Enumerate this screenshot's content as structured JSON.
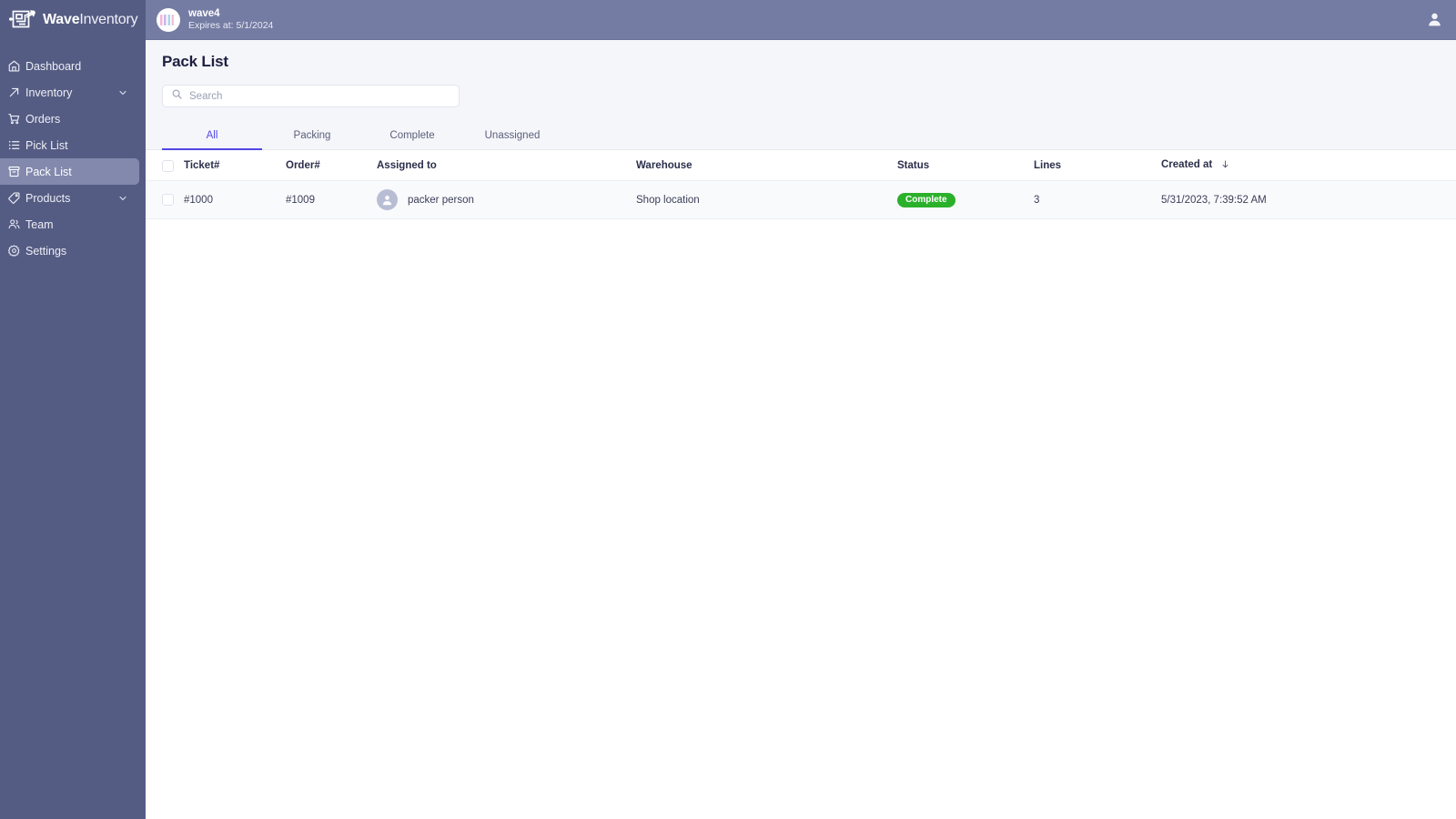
{
  "brand": {
    "name_bold": "Wave",
    "name_light": "Inventory",
    "logo_icon": "maze-arrow-icon"
  },
  "sidebar": {
    "items": [
      {
        "label": "Dashboard",
        "icon": "home-icon",
        "active": false,
        "expandable": false
      },
      {
        "label": "Inventory",
        "icon": "arrow-up-right-icon",
        "active": false,
        "expandable": true
      },
      {
        "label": "Orders",
        "icon": "shopping-cart-icon",
        "active": false,
        "expandable": false
      },
      {
        "label": "Pick List",
        "icon": "list-icon",
        "active": false,
        "expandable": false
      },
      {
        "label": "Pack List",
        "icon": "box-icon",
        "active": true,
        "expandable": false
      },
      {
        "label": "Products",
        "icon": "tag-icon",
        "active": false,
        "expandable": true
      },
      {
        "label": "Team",
        "icon": "people-icon",
        "active": false,
        "expandable": false
      },
      {
        "label": "Settings",
        "icon": "gear-icon",
        "active": false,
        "expandable": false
      }
    ]
  },
  "topbar": {
    "workspace_name": "wave4",
    "workspace_expires": "Expires at: 5/1/2024",
    "workspace_avatar_icon": "workspace-avatar",
    "user_icon": "user-account-icon"
  },
  "page": {
    "title": "Pack List"
  },
  "search": {
    "placeholder": "Search",
    "value": "",
    "icon": "search-icon"
  },
  "tabs": [
    {
      "label": "All",
      "active": true
    },
    {
      "label": "Packing",
      "active": false
    },
    {
      "label": "Complete",
      "active": false
    },
    {
      "label": "Unassigned",
      "active": false
    }
  ],
  "table": {
    "columns": [
      {
        "key": "checkbox",
        "label": ""
      },
      {
        "key": "ticket",
        "label": "Ticket#"
      },
      {
        "key": "order",
        "label": "Order#"
      },
      {
        "key": "assigned",
        "label": "Assigned to"
      },
      {
        "key": "warehouse",
        "label": "Warehouse"
      },
      {
        "key": "status",
        "label": "Status"
      },
      {
        "key": "lines",
        "label": "Lines"
      },
      {
        "key": "created",
        "label": "Created at"
      }
    ],
    "sort": {
      "column": "Created at",
      "direction": "desc",
      "icon": "arrow-down-icon"
    },
    "header_checkbox_checked": false,
    "rows": [
      {
        "checked": false,
        "ticket": "#1000",
        "order": "#1009",
        "assigned_to": "packer person",
        "assigned_avatar_icon": "person-avatar-icon",
        "warehouse": "Shop location",
        "status": "Complete",
        "status_color": "#2bb02b",
        "lines": "3",
        "created_at": "5/31/2023, 7:39:52 AM"
      }
    ]
  },
  "colors": {
    "sidebar_bg": "#555c83",
    "sidebar_active": "#8289ad",
    "topbar_bg": "#757ca3",
    "accent": "#5048e5",
    "page_bg": "#f5f6fa",
    "status_complete": "#2bb02b"
  }
}
